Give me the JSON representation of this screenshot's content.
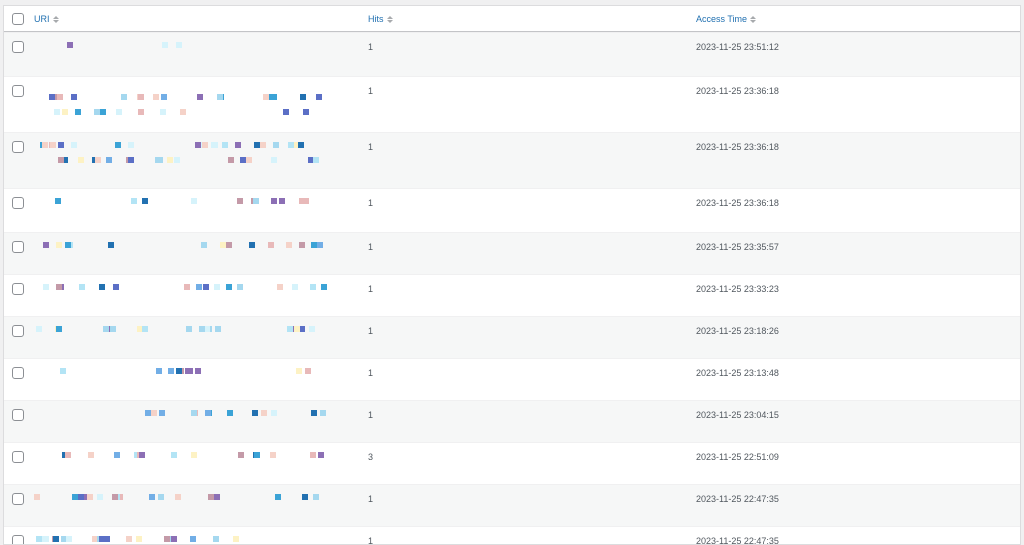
{
  "columns": {
    "uri": "URI",
    "hits": "Hits",
    "access_time": "Access Time"
  },
  "colors": {
    "link": "#2271b1",
    "border": "#dcdcde",
    "row_alt": "#f6f7f7"
  },
  "rows": [
    {
      "hits": "1",
      "time": "2023-11-25 23:51:12"
    },
    {
      "hits": "1",
      "time": "2023-11-25 23:36:18"
    },
    {
      "hits": "1",
      "time": "2023-11-25 23:36:18"
    },
    {
      "hits": "1",
      "time": "2023-11-25 23:36:18"
    },
    {
      "hits": "1",
      "time": "2023-11-25 23:35:57"
    },
    {
      "hits": "1",
      "time": "2023-11-25 23:33:23"
    },
    {
      "hits": "1",
      "time": "2023-11-25 23:18:26"
    },
    {
      "hits": "1",
      "time": "2023-11-25 23:13:48"
    },
    {
      "hits": "1",
      "time": "2023-11-25 23:04:15"
    },
    {
      "hits": "3",
      "time": "2023-11-25 22:51:09"
    },
    {
      "hits": "1",
      "time": "2023-11-25 22:47:35"
    },
    {
      "hits": "1",
      "time": "2023-11-25 22:47:35"
    }
  ]
}
